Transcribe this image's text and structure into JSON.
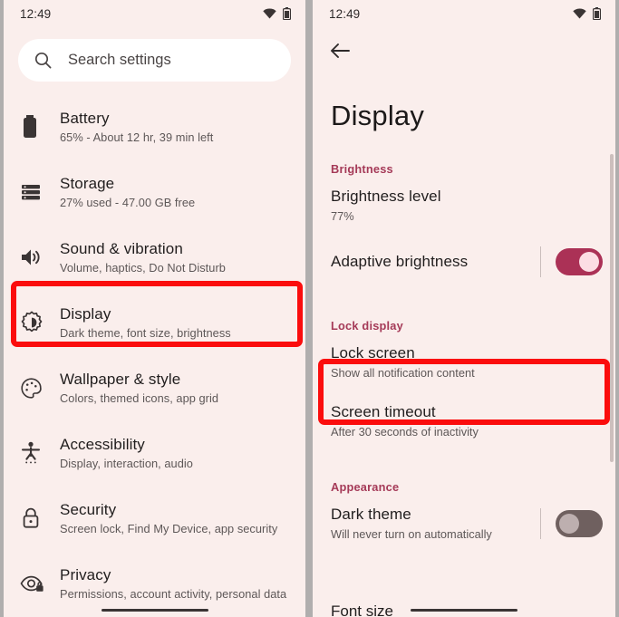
{
  "status": {
    "time": "12:49",
    "wifi_icon": "wifi-icon",
    "battery_icon": "battery-icon"
  },
  "left_panel": {
    "search": {
      "placeholder": "Search settings",
      "icon": "search-icon"
    },
    "items": [
      {
        "icon": "battery-icon",
        "title": "Battery",
        "subtitle": "65% - About 12 hr, 39 min left",
        "highlighted": false
      },
      {
        "icon": "storage-icon",
        "title": "Storage",
        "subtitle": "27% used - 47.00 GB free",
        "highlighted": false
      },
      {
        "icon": "sound-icon",
        "title": "Sound & vibration",
        "subtitle": "Volume, haptics, Do Not Disturb",
        "highlighted": false
      },
      {
        "icon": "display-brightness-icon",
        "title": "Display",
        "subtitle": "Dark theme, font size, brightness",
        "highlighted": true
      },
      {
        "icon": "palette-icon",
        "title": "Wallpaper & style",
        "subtitle": "Colors, themed icons, app grid",
        "highlighted": false
      },
      {
        "icon": "accessibility-icon",
        "title": "Accessibility",
        "subtitle": "Display, interaction, audio",
        "highlighted": false
      },
      {
        "icon": "lock-icon",
        "title": "Security",
        "subtitle": "Screen lock, Find My Device, app security",
        "highlighted": false
      },
      {
        "icon": "privacy-eye-icon",
        "title": "Privacy",
        "subtitle": "Permissions, account activity, personal data",
        "highlighted": false
      }
    ]
  },
  "right_panel": {
    "back_icon": "back-arrow-icon",
    "title": "Display",
    "sections": [
      {
        "header": "Brightness",
        "rows": [
          {
            "title": "Brightness level",
            "subtitle": "77%",
            "control": "none",
            "highlighted": false
          },
          {
            "title": "Adaptive brightness",
            "subtitle": "",
            "control": "toggle",
            "toggle_state": "on",
            "highlighted": false
          }
        ]
      },
      {
        "header": "Lock display",
        "rows": [
          {
            "title": "Lock screen",
            "subtitle": "Show all notification content",
            "control": "none",
            "highlighted": true
          },
          {
            "title": "Screen timeout",
            "subtitle": "After 30 seconds of inactivity",
            "control": "none",
            "highlighted": false
          }
        ]
      },
      {
        "header": "Appearance",
        "rows": [
          {
            "title": "Dark theme",
            "subtitle": "Will never turn on automatically",
            "control": "toggle",
            "toggle_state": "off",
            "highlighted": false
          },
          {
            "title": "Font size",
            "subtitle": "",
            "control": "none",
            "highlighted": false
          }
        ]
      }
    ]
  },
  "colors": {
    "background": "#faeeec",
    "highlight_red": "#fb0d0d",
    "accent_maroon": "#a53a58",
    "toggle_on": "#ab3156",
    "toggle_off": "#6f605f"
  }
}
